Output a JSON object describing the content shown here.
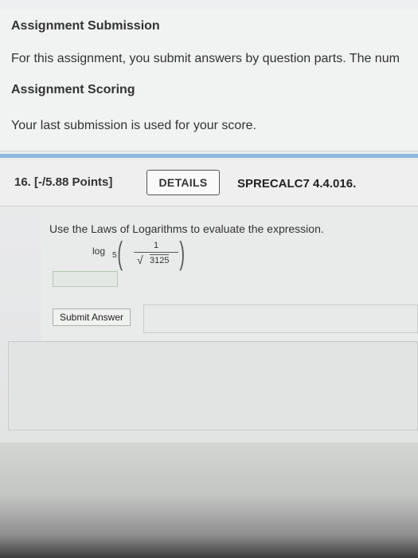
{
  "info": {
    "assignment_submission_title": "Assignment Submission",
    "assignment_submission_text": "For this assignment, you submit answers by question parts. The num",
    "assignment_scoring_title": "Assignment Scoring",
    "assignment_scoring_text": "Your last submission is used for your score."
  },
  "question": {
    "number_points": "16. [-/5.88 Points]",
    "details_label": "DETAILS",
    "code": "SPRECALC7 4.4.016.",
    "prompt": "Use the Laws of Logarithms to evaluate the expression.",
    "expression": {
      "log": "log",
      "base": "5",
      "numerator": "1",
      "radicand": "3125"
    },
    "answer_value": "",
    "submit_label": "Submit Answer"
  },
  "colors": {
    "accent_rule": "#8fb8dc",
    "background": "#eeeff0"
  },
  "icons": {
    "sqrt": "square-root-symbol"
  }
}
